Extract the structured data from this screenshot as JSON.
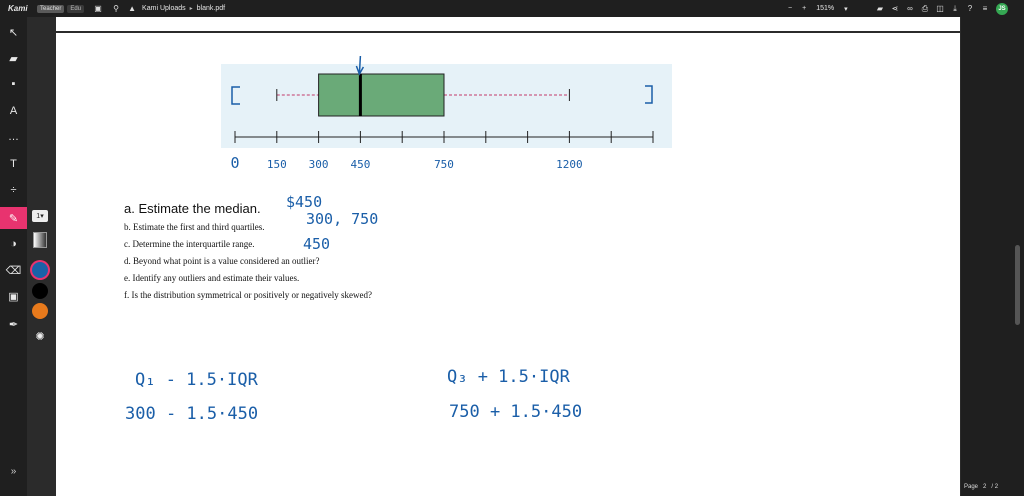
{
  "app": {
    "logo": "Kami",
    "badges": [
      "Teacher",
      "Edu"
    ],
    "breadcrumb": [
      "Kami Uploads",
      "blank.pdf"
    ],
    "zoom_level": "151%",
    "user_initials": "JS",
    "page_label": "Page",
    "page_current": "2",
    "page_total": "/ 2"
  },
  "left_tools": [
    {
      "name": "select-tool-button",
      "glyph": "↖"
    },
    {
      "name": "markup-tool-button",
      "glyph": "▰"
    },
    {
      "name": "comment-tool-button",
      "glyph": "▪"
    },
    {
      "name": "text-highlight-tool-button",
      "glyph": "A"
    },
    {
      "name": "speech-tool-button",
      "glyph": "…"
    },
    {
      "name": "text-tool-button",
      "glyph": "T"
    },
    {
      "name": "equation-tool-button",
      "glyph": "÷"
    },
    {
      "name": "drawing-tool-button",
      "glyph": "✎"
    },
    {
      "name": "shapes-tool-button",
      "glyph": "◑"
    },
    {
      "name": "eraser-tool-button",
      "glyph": "⌫"
    },
    {
      "name": "image-tool-button",
      "glyph": "▣"
    },
    {
      "name": "signature-tool-button",
      "glyph": "✒"
    }
  ],
  "palette": {
    "size_value": "1",
    "colors": {
      "blue": "#1a62a8",
      "black": "#000000",
      "orange": "#e87a1c",
      "active_tool": "#e8336f"
    }
  },
  "boxplot": {
    "min": 150,
    "q1": 300,
    "median": 450,
    "q3": 750,
    "max": 1200,
    "axis_min": 0,
    "axis_max": 1500,
    "tick_step": 150,
    "box_color": "#6aaa78",
    "whisker_color": "#c23a6a"
  },
  "handwriting": {
    "axis_labels": [
      {
        "value": 0,
        "text": "0"
      },
      {
        "value": 150,
        "text": "150"
      },
      {
        "value": 300,
        "text": "300"
      },
      {
        "value": 450,
        "text": "450"
      },
      {
        "value": 750,
        "text": "750"
      },
      {
        "value": 1200,
        "text": "1200"
      }
    ],
    "answer_a": "$450",
    "answer_b": "300, 750",
    "answer_c": "450",
    "left_formula": "Q₁ - 1.5·IQR",
    "left_work": "300 - 1.5·450",
    "right_formula": "Q₃ + 1.5·IQR",
    "right_work": "750 + 1.5·450"
  },
  "questions": {
    "a": "a. Estimate the median.",
    "b": "b. Estimate the first and third quartiles.",
    "c": "c. Determine the interquartile range.",
    "d": "d. Beyond what point is a value considered an outlier?",
    "e": "e. Identify any outliers and estimate their values.",
    "f": "f. Is the distribution symmetrical or positively or negatively skewed?"
  }
}
